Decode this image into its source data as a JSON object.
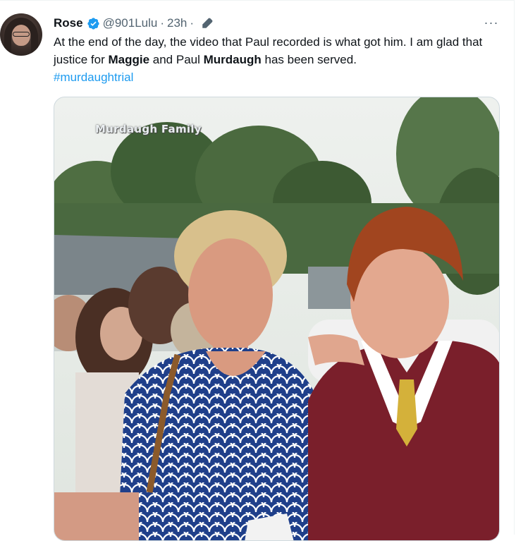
{
  "tweet": {
    "author_name": "Rose",
    "handle": "@901Lulu",
    "separator": "·",
    "time": "23h",
    "separator2": "·",
    "text_part1": "At the end of the day, the video that Paul recorded is what got him. I am glad that justice for ",
    "text_bold1": "Maggie",
    "text_part2": " and Paul ",
    "text_bold2": "Murdaugh",
    "text_part3": " has been served.",
    "hashtag": "#murdaughtrial",
    "more_label": "···",
    "media_watermark": "Murdaugh Family"
  },
  "colors": {
    "accent": "#1d9bf0",
    "secondary_text": "#536471",
    "maroon_gown": "#7a1f2b",
    "dress_blue": "#1f3f8a"
  },
  "icons": {
    "verified": "verified-badge-icon",
    "edit": "edited-pencil-icon",
    "more": "more-options-icon"
  }
}
